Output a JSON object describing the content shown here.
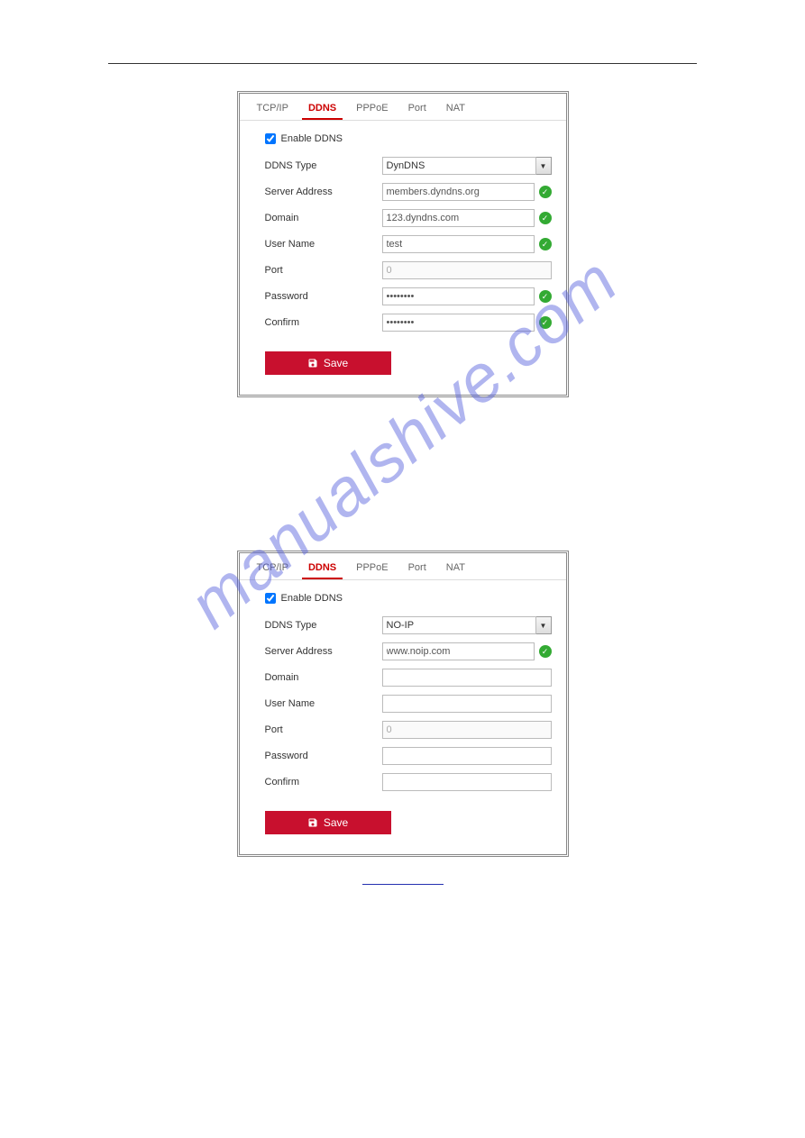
{
  "watermark": "manualshive.com",
  "tabs": [
    "TCP/IP",
    "DDNS",
    "PPPoE",
    "Port",
    "NAT"
  ],
  "active_tab": "DDNS",
  "enable_label": "Enable DDNS",
  "labels": {
    "ddns_type": "DDNS Type",
    "server_address": "Server Address",
    "domain": "Domain",
    "user_name": "User Name",
    "port": "Port",
    "password": "Password",
    "confirm": "Confirm"
  },
  "save_label": "Save",
  "panel1": {
    "ddns_type": "DynDNS",
    "server_address": "members.dyndns.org",
    "domain": "123.dyndns.com",
    "user_name": "test",
    "port": "0",
    "password": "••••••••",
    "confirm": "••••••••",
    "valid": {
      "server_address": true,
      "domain": true,
      "user_name": true,
      "password": true,
      "confirm": true
    }
  },
  "panel2": {
    "ddns_type": "NO-IP",
    "server_address": "www.noip.com",
    "domain": "",
    "user_name": "",
    "port": "0",
    "password": "",
    "confirm": "",
    "valid": {
      "server_address": true
    }
  }
}
